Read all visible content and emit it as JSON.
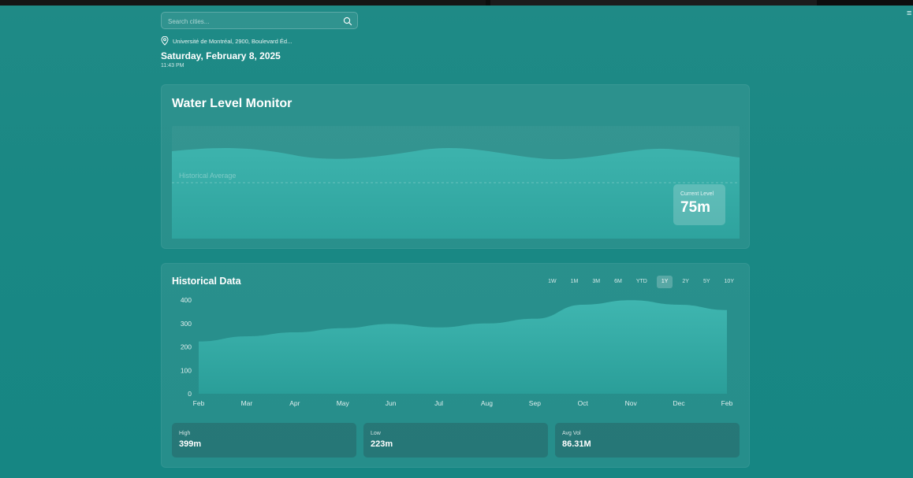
{
  "search": {
    "placeholder": "Search cities...",
    "icon": "search-icon"
  },
  "menu": {
    "icon": "hamburger-menu-icon"
  },
  "location": {
    "icon": "map-pin-icon",
    "text": "Université de Montréal, 2900, Boulevard Éd..."
  },
  "date": "Saturday, February 8, 2025",
  "time": "11:43 PM",
  "monitor": {
    "title": "Water Level Monitor",
    "average_label": "Historical Average",
    "current_label": "Current Level",
    "current_value": "75m",
    "current_level_fraction": 0.75,
    "accent_color": "#3aaea8"
  },
  "history": {
    "title": "Historical Data",
    "ranges": [
      "1W",
      "1M",
      "3M",
      "6M",
      "YTD",
      "1Y",
      "2Y",
      "5Y",
      "10Y"
    ],
    "active_range": "1Y",
    "stats": [
      {
        "label": "High",
        "value": "399m"
      },
      {
        "label": "Low",
        "value": "223m"
      },
      {
        "label": "Avg Vol",
        "value": "86.31M"
      }
    ]
  },
  "chart_data": {
    "type": "area",
    "x": [
      "Feb",
      "Mar",
      "Apr",
      "May",
      "Jun",
      "Jul",
      "Aug",
      "Sep",
      "Oct",
      "Nov",
      "Dec",
      "Feb"
    ],
    "values": [
      223,
      245,
      262,
      280,
      298,
      283,
      300,
      320,
      380,
      399,
      380,
      357
    ],
    "ylim": [
      0,
      400
    ],
    "yticks": [
      0,
      100,
      200,
      300,
      400
    ],
    "grid": false,
    "title": "",
    "xlabel": "",
    "ylabel": ""
  }
}
